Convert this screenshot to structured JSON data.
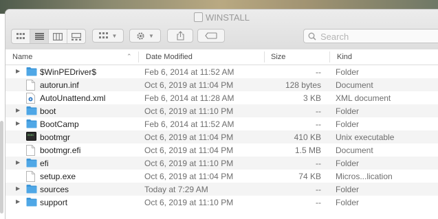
{
  "window": {
    "title": "WINSTALL"
  },
  "toolbar": {
    "view_buttons": [
      "icon-view-icon",
      "list-view-icon",
      "column-view-icon",
      "gallery-view-icon"
    ],
    "group_icon": "group-by-icon",
    "action_icon": "gear-icon",
    "share_icon": "share-icon",
    "tag_icon": "tag-icon",
    "search_placeholder": "Search"
  },
  "columns": {
    "name": "Name",
    "date": "Date Modified",
    "size": "Size",
    "kind": "Kind"
  },
  "files": [
    {
      "name": "$WinPEDriver$",
      "date": "Feb 6, 2014 at 11:52 AM",
      "size": "--",
      "kind": "Folder",
      "type": "folder"
    },
    {
      "name": "autorun.inf",
      "date": "Oct 6, 2019 at 11:04 PM",
      "size": "128 bytes",
      "kind": "Document",
      "type": "doc"
    },
    {
      "name": "AutoUnattend.xml",
      "date": "Feb 6, 2014 at 11:28 AM",
      "size": "3 KB",
      "kind": "XML document",
      "type": "xml"
    },
    {
      "name": "boot",
      "date": "Oct 6, 2019 at 11:10 PM",
      "size": "--",
      "kind": "Folder",
      "type": "folder"
    },
    {
      "name": "BootCamp",
      "date": "Feb 6, 2014 at 11:52 AM",
      "size": "--",
      "kind": "Folder",
      "type": "folder"
    },
    {
      "name": "bootmgr",
      "date": "Oct 6, 2019 at 11:04 PM",
      "size": "410 KB",
      "kind": "Unix executable",
      "type": "exec"
    },
    {
      "name": "bootmgr.efi",
      "date": "Oct 6, 2019 at 11:04 PM",
      "size": "1.5 MB",
      "kind": "Document",
      "type": "doc"
    },
    {
      "name": "efi",
      "date": "Oct 6, 2019 at 11:10 PM",
      "size": "--",
      "kind": "Folder",
      "type": "folder"
    },
    {
      "name": "setup.exe",
      "date": "Oct 6, 2019 at 11:04 PM",
      "size": "74 KB",
      "kind": "Micros...lication",
      "type": "doc"
    },
    {
      "name": "sources",
      "date": "Today at 7:29 AM",
      "size": "--",
      "kind": "Folder",
      "type": "folder"
    },
    {
      "name": "support",
      "date": "Oct 6, 2019 at 11:10 PM",
      "size": "--",
      "kind": "Folder",
      "type": "folder"
    }
  ],
  "colors": {
    "folder": "#4fa7e6",
    "folder_tab": "#3d96d8",
    "alt_row": "#f4f4f4"
  }
}
